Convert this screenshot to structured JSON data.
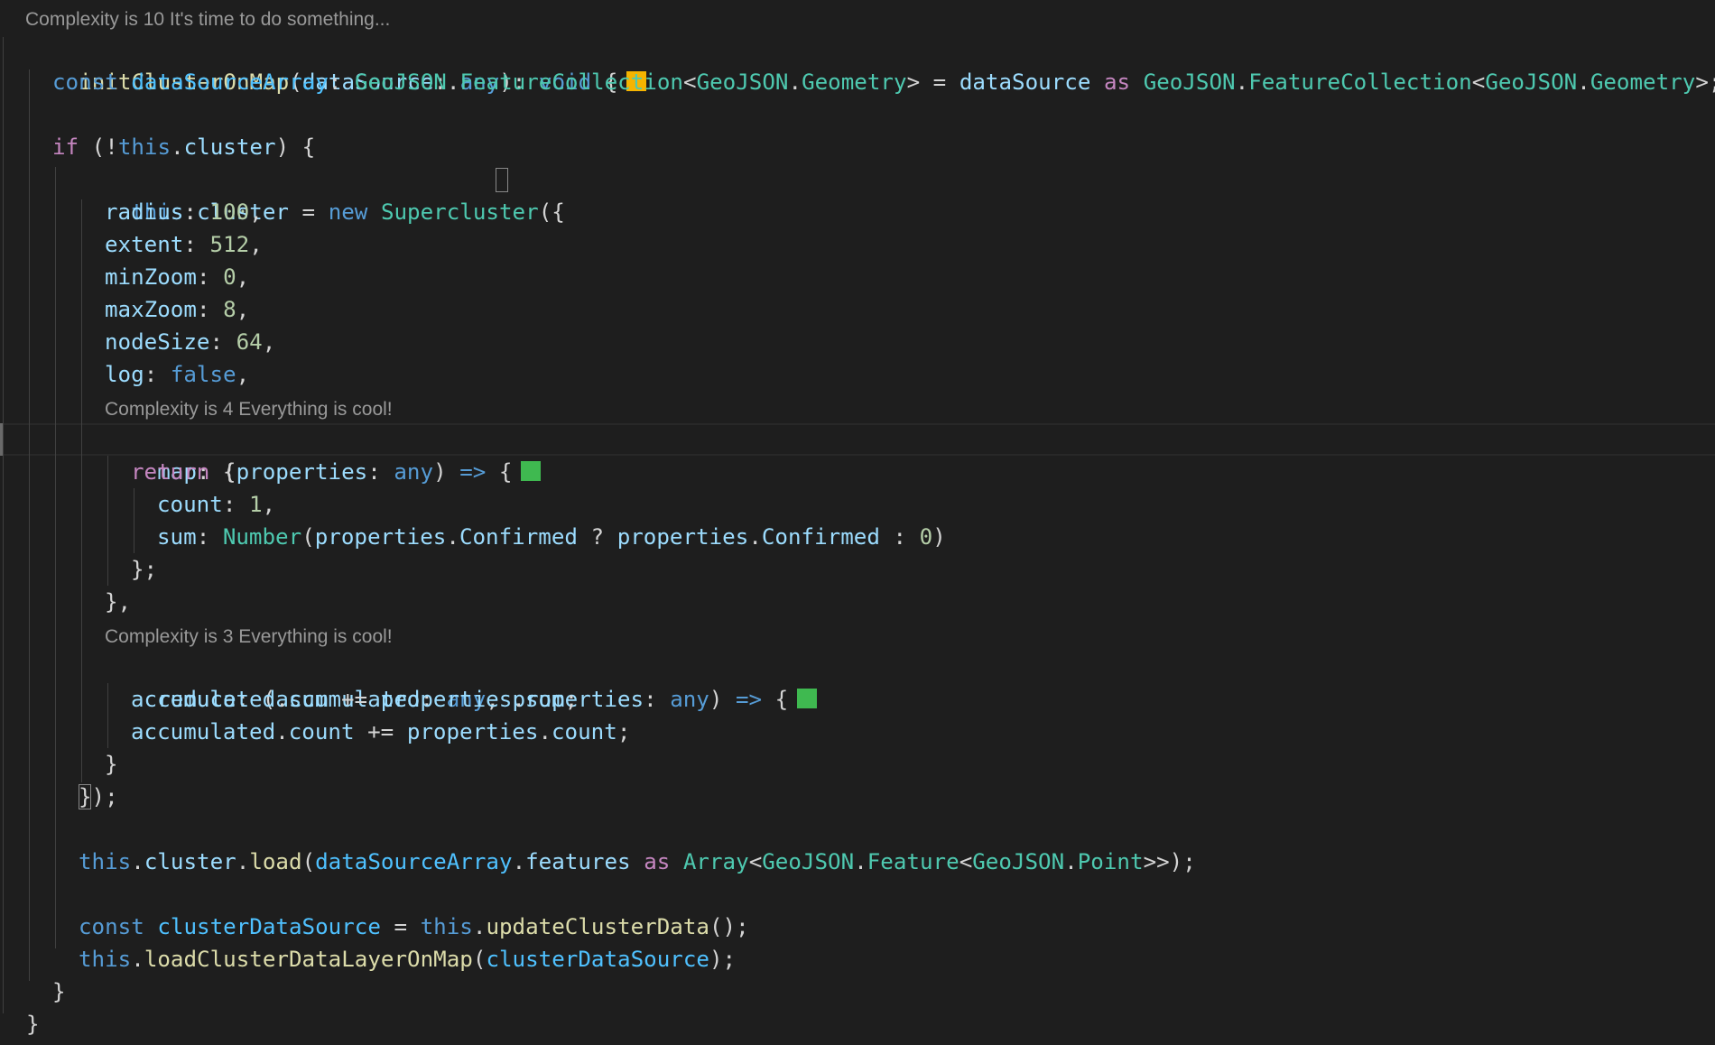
{
  "editor": {
    "codelens": {
      "function": "Complexity is 10 It's time to do something...",
      "map": "Complexity is 4 Everything is cool!",
      "reduce": "Complexity is 3 Everything is cool!"
    },
    "badge_colors": {
      "warning": "#f5b400",
      "ok": "#3fb950"
    },
    "lines": [
      "initClusterOnMap(dataSource: any): void {",
      "const dataSourceArray: GeoJSON.FeatureCollection<GeoJSON.Geometry> = dataSource as GeoJSON.FeatureCollection<GeoJSON.Geometry>;",
      "",
      "if (!this.cluster) {",
      "this.cluster = new Supercluster({",
      "radius: 100,",
      "extent: 512,",
      "minZoom: 0,",
      "maxZoom: 8,",
      "nodeSize: 64,",
      "log: false,",
      "map: (properties: any) => {",
      "return {",
      "count: 1,",
      "sum: Number(properties.Confirmed ? properties.Confirmed : 0)",
      "};",
      "},",
      "reduce: (accumulated: any, properties: any) => {",
      "accumulated.sum += properties.sum;",
      "accumulated.count += properties.count;",
      "}",
      "});",
      "",
      "this.cluster.load(dataSourceArray.features as Array<GeoJSON.Feature<GeoJSON.Point>>);",
      "",
      "const clusterDataSource = this.updateClusterData();",
      "this.loadClusterDataLayerOnMap(clusterDataSource);",
      "}",
      "}"
    ]
  }
}
